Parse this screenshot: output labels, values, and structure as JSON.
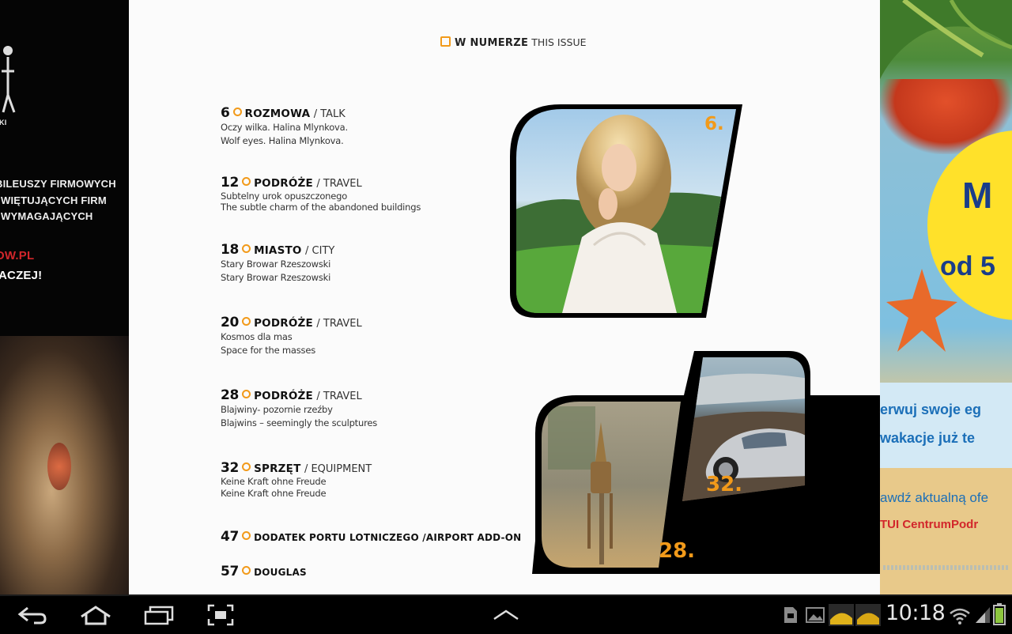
{
  "left_page": {
    "lines": [
      "BILEUSZY FIRMOWYCH",
      "WIĘTUJĄCYCH FIRM",
      "WYMAGAJĄCYCH"
    ],
    "red_text": "OW.PL",
    "white_text": "ACZEJ!",
    "logo_text": "KI"
  },
  "header": {
    "pl": "W NUMERZE",
    "en": "THIS ISSUE"
  },
  "toc": [
    {
      "num": "6",
      "cat": "ROZMOWA",
      "en": "/ TALK",
      "desc": [
        "Oczy wilka. Halina Mlynkova.",
        "Wolf eyes. Halina Mlynkova."
      ]
    },
    {
      "num": "12",
      "cat": "PODRÓŻE",
      "en": "/ TRAVEL",
      "desc": [
        "Subtelny urok opuszczonego",
        "The subtle charm of the abandoned buildings"
      ]
    },
    {
      "num": "18",
      "cat": "MIASTO",
      "en": "/ CITY",
      "desc": [
        "Stary Browar Rzeszowski",
        "Stary Browar Rzeszowski"
      ]
    },
    {
      "num": "20",
      "cat": "PODRÓŻE",
      "en": "/ TRAVEL",
      "desc": [
        "Kosmos dla mas",
        "Space for the masses"
      ]
    },
    {
      "num": "28",
      "cat": "PODRÓŻE",
      "en": "/ TRAVEL",
      "desc": [
        "Blajwiny- pozornie rzeźby",
        "Blajwins – seemingly the sculptures"
      ]
    },
    {
      "num": "32",
      "cat": "SPRZĘT",
      "en": "/ EQUIPMENT",
      "desc": [
        "Keine Kraft ohne Freude",
        "Keine Kraft ohne Freude"
      ]
    },
    {
      "num": "47",
      "cat": "DODATEK PORTU LOTNICZEGO /AIRPORT ADD-ON",
      "en": "",
      "desc": []
    },
    {
      "num": "57",
      "cat": "DOUGLAS",
      "en": "",
      "desc": []
    }
  ],
  "photos": {
    "p1_num": "6.",
    "p2_num_a": "32.",
    "p2_num_b": "28."
  },
  "right_page": {
    "big": "M",
    "od": "od 5",
    "line1": "erwuj swoje eg",
    "line2": "wakacje już te",
    "line3": "awdź aktualną ofe",
    "brand": "TUI CentrumPodr"
  },
  "navbar": {
    "back": "back-icon",
    "home": "home-icon",
    "recent": "recent-apps-icon",
    "screenshot": "screenshot-icon",
    "up": "chevron-up-icon",
    "time": "10:18"
  },
  "colors": {
    "accent": "#f29a1a",
    "page_bg": "#fbfbfb",
    "navbar_bg": "#000000"
  }
}
